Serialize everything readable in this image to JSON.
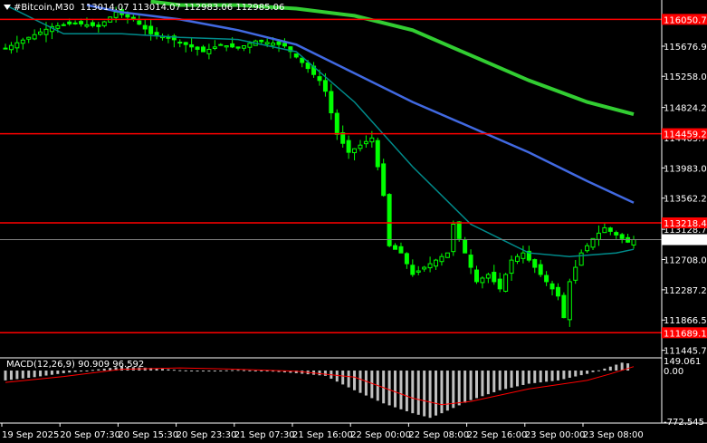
{
  "header": {
    "symbol": "#Bitcoin,M30",
    "ohlc": "113014.07 113014.07 112983.06 112985.06"
  },
  "macd": {
    "label": "MACD(12,26,9) 90.909 96.592"
  },
  "colors": {
    "background": "#000000",
    "candle": "#00ff00",
    "ma_fast": "#008b8b",
    "ma_mid": "#4169e1",
    "ma_slow": "#32cd32",
    "level_line": "#ff0000",
    "macd_hist": "#c0c0c0",
    "macd_signal": "#ff0000"
  },
  "chart_data": {
    "type": "candlestick",
    "title": "#Bitcoin,M30",
    "y_ticks": [
      "116050.75",
      "115676.98",
      "115258.00",
      "114824.25",
      "114403.75",
      "113983.00",
      "113562.25",
      "113128.75",
      "112708.00",
      "112287.25",
      "111866.50",
      "111445.75"
    ],
    "ylim": [
      111340,
      116320
    ],
    "price_tags": [
      {
        "label": "116050.75",
        "value": 116050.75,
        "style": "red"
      },
      {
        "label": "114459.26",
        "value": 114459.26,
        "style": "red"
      },
      {
        "label": "113218.43",
        "value": 113218.43,
        "style": "red"
      },
      {
        "label": "112985.06",
        "value": 112985.06,
        "style": "current"
      },
      {
        "label": "111689.14",
        "value": 111689.14,
        "style": "red"
      }
    ],
    "levels": [
      116050.75,
      114459.26,
      113218.43,
      111689.14
    ],
    "current_price": 112985.06,
    "x_labels": [
      "19 Sep 2025",
      "20 Sep 07:30",
      "20 Sep 15:30",
      "20 Sep 23:30",
      "21 Sep 07:30",
      "21 Sep 16:00",
      "22 Sep 00:00",
      "22 Sep 08:00",
      "22 Sep 16:00",
      "23 Sep 00:00",
      "23 Sep 08:00"
    ],
    "close_path": [
      [
        0,
        115650
      ],
      [
        4,
        115800
      ],
      [
        8,
        115950
      ],
      [
        12,
        116000
      ],
      [
        16,
        115950
      ],
      [
        19,
        116150
      ],
      [
        22,
        116050
      ],
      [
        25,
        115850
      ],
      [
        28,
        115800
      ],
      [
        31,
        115700
      ],
      [
        34,
        115600
      ],
      [
        37,
        115700
      ],
      [
        40,
        115650
      ],
      [
        43,
        115750
      ],
      [
        46,
        115720
      ],
      [
        48,
        115680
      ],
      [
        51,
        115450
      ],
      [
        54,
        115200
      ],
      [
        55,
        115050
      ],
      [
        57,
        114450
      ],
      [
        59,
        114200
      ],
      [
        61,
        114300
      ],
      [
        63,
        114400
      ],
      [
        65,
        113600
      ],
      [
        66,
        112900
      ],
      [
        68,
        112800
      ],
      [
        70,
        112500
      ],
      [
        72,
        112600
      ],
      [
        74,
        112700
      ],
      [
        76,
        112800
      ],
      [
        77,
        113200
      ],
      [
        79,
        112800
      ],
      [
        81,
        112400
      ],
      [
        83,
        112500
      ],
      [
        85,
        112300
      ],
      [
        87,
        112700
      ],
      [
        89,
        112800
      ],
      [
        91,
        112600
      ],
      [
        93,
        112400
      ],
      [
        95,
        112200
      ],
      [
        96,
        111900
      ],
      [
        97,
        112400
      ],
      [
        99,
        112800
      ],
      [
        101,
        113000
      ],
      [
        103,
        113150
      ],
      [
        105,
        113050
      ],
      [
        107,
        112950
      ],
      [
        108,
        112985
      ]
    ],
    "ma_fast": [
      [
        0,
        116250
      ],
      [
        10,
        115850
      ],
      [
        20,
        115850
      ],
      [
        30,
        115800
      ],
      [
        40,
        115770
      ],
      [
        50,
        115600
      ],
      [
        60,
        114900
      ],
      [
        70,
        114000
      ],
      [
        80,
        113200
      ],
      [
        90,
        112800
      ],
      [
        97,
        112750
      ],
      [
        105,
        112800
      ],
      [
        108,
        112850
      ]
    ],
    "ma_mid": [
      [
        14,
        116250
      ],
      [
        20,
        116150
      ],
      [
        30,
        116050
      ],
      [
        40,
        115900
      ],
      [
        50,
        115700
      ],
      [
        60,
        115300
      ],
      [
        70,
        114900
      ],
      [
        80,
        114550
      ],
      [
        90,
        114200
      ],
      [
        100,
        113800
      ],
      [
        108,
        113500
      ]
    ],
    "ma_slow": [
      [
        25,
        116300
      ],
      [
        30,
        116250
      ],
      [
        40,
        116250
      ],
      [
        50,
        116200
      ],
      [
        60,
        116100
      ],
      [
        70,
        115900
      ],
      [
        80,
        115550
      ],
      [
        90,
        115200
      ],
      [
        100,
        114900
      ],
      [
        108,
        114730
      ]
    ],
    "macd_ylim": [
      -800,
      180
    ],
    "macd_ticks": [
      "149.061",
      "0.00",
      "-772.545"
    ],
    "macd_hist": [
      [
        0,
        -150
      ],
      [
        5,
        -100
      ],
      [
        10,
        -40
      ],
      [
        15,
        10
      ],
      [
        20,
        60
      ],
      [
        25,
        40
      ],
      [
        30,
        5
      ],
      [
        35,
        -5
      ],
      [
        40,
        10
      ],
      [
        45,
        -10
      ],
      [
        50,
        -40
      ],
      [
        55,
        -80
      ],
      [
        60,
        -300
      ],
      [
        65,
        -500
      ],
      [
        70,
        -650
      ],
      [
        73,
        -720
      ],
      [
        75,
        -650
      ],
      [
        80,
        -450
      ],
      [
        85,
        -300
      ],
      [
        90,
        -200
      ],
      [
        95,
        -150
      ],
      [
        100,
        -50
      ],
      [
        103,
        30
      ],
      [
        106,
        120
      ],
      [
        108,
        100
      ]
    ],
    "macd_signal": [
      [
        0,
        -180
      ],
      [
        10,
        -90
      ],
      [
        20,
        20
      ],
      [
        30,
        40
      ],
      [
        40,
        20
      ],
      [
        50,
        -10
      ],
      [
        60,
        -100
      ],
      [
        70,
        -420
      ],
      [
        75,
        -520
      ],
      [
        80,
        -470
      ],
      [
        90,
        -280
      ],
      [
        100,
        -150
      ],
      [
        104,
        -50
      ],
      [
        108,
        60
      ]
    ]
  }
}
